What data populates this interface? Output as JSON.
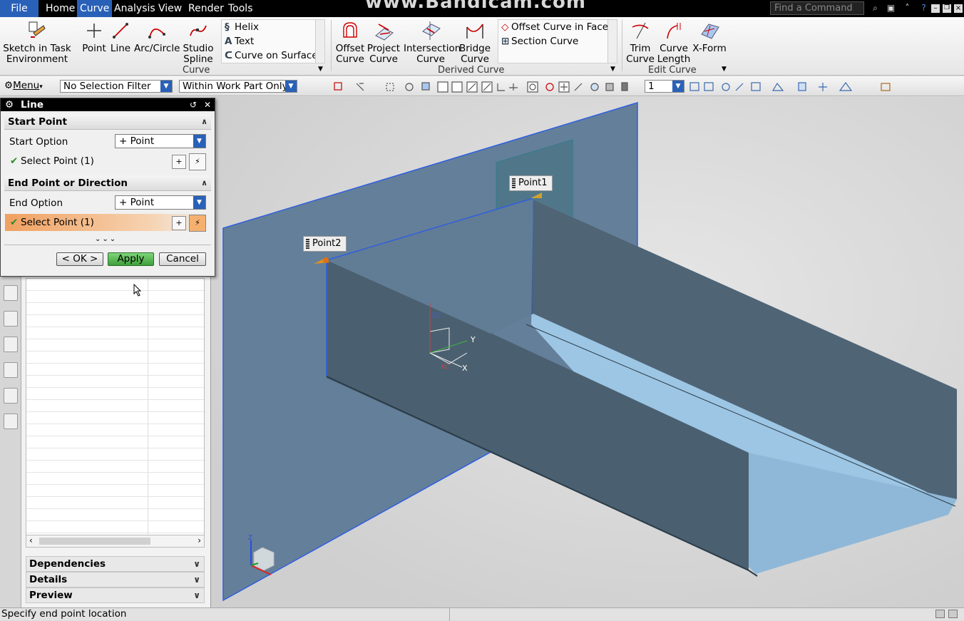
{
  "menubar": {
    "file": "File",
    "tabs": [
      "Home",
      "Curve",
      "Analysis",
      "View",
      "Render",
      "Tools"
    ],
    "active_tab": "Curve",
    "watermark": "www.Bandicam.com",
    "find_command_placeholder": "Find a Command"
  },
  "ribbon": {
    "sketch": "Sketch in Task Environment",
    "point": "Point",
    "line": "Line",
    "arc_circle": "Arc/Circle",
    "studio_spline": "Studio Spline",
    "curve_list": [
      "Helix",
      "Text",
      "Curve on Surface"
    ],
    "curve_group": "Curve",
    "offset_curve": "Offset Curve",
    "project_curve": "Project Curve",
    "intersection_curve": "Intersection Curve",
    "bridge_curve": "Bridge Curve",
    "derived_list": [
      "Offset Curve in Face",
      "Section Curve"
    ],
    "derived_group": "Derived Curve",
    "trim_curve": "Trim Curve",
    "curve_length": "Curve Length",
    "xform": "X-Form",
    "edit_group": "Edit Curve"
  },
  "selbar": {
    "menu": "Menu",
    "filter": "No Selection Filter",
    "scope": "Within Work Part Only",
    "layer": "1"
  },
  "dialog": {
    "title": "Line",
    "start_group": "Start Point",
    "start_option_label": "Start Option",
    "start_option_value": "Point",
    "start_select": "Select Point (1)",
    "end_group": "End Point or Direction",
    "end_option_label": "End Option",
    "end_option_value": "Point",
    "end_select": "Select Point (1)",
    "ok": "< OK >",
    "apply": "Apply",
    "cancel": "Cancel"
  },
  "nav": {
    "sections": [
      "Dependencies",
      "Details",
      "Preview"
    ]
  },
  "viewport": {
    "point1": "Point1",
    "point2": "Point2",
    "axis_y": "Y",
    "axis_x": "X",
    "axis_zc": "ZC",
    "axis_xc": "XC",
    "axis_z": "Z"
  },
  "status": "Specify end point location",
  "colors": {
    "accent": "#2a61b8",
    "apply_green": "#3e9e3a",
    "highlight_orange": "#f0a060",
    "model_surface": "#5a7a92",
    "model_floor": "#9fc8e3"
  }
}
